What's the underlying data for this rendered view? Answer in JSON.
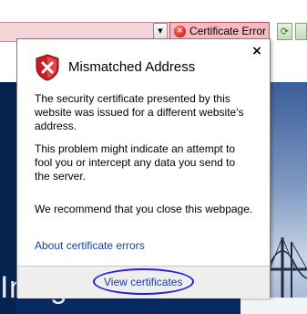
{
  "toolbar": {
    "cert_error_label": "Certificate Error",
    "refresh_icon": "refresh-icon",
    "stop_icon": "stop-icon",
    "dropdown_glyph": "▼"
  },
  "page": {
    "heading": "Insight Center"
  },
  "popup": {
    "title": "Mismatched Address",
    "close_glyph": "×",
    "paragraph1": "The security certificate presented by this website was issued for a different website's address.",
    "paragraph2": "This problem might indicate an attempt to fool you or intercept any data you send to the server.",
    "paragraph3": "We recommend that you close this webpage.",
    "about_link": "About certificate errors",
    "view_certificates": "View certificates"
  },
  "colors": {
    "link": "#1a3cb4",
    "error_bar": "#f8b9c3",
    "page_banner": "#0a2a63",
    "annotation": "#2323c8"
  }
}
